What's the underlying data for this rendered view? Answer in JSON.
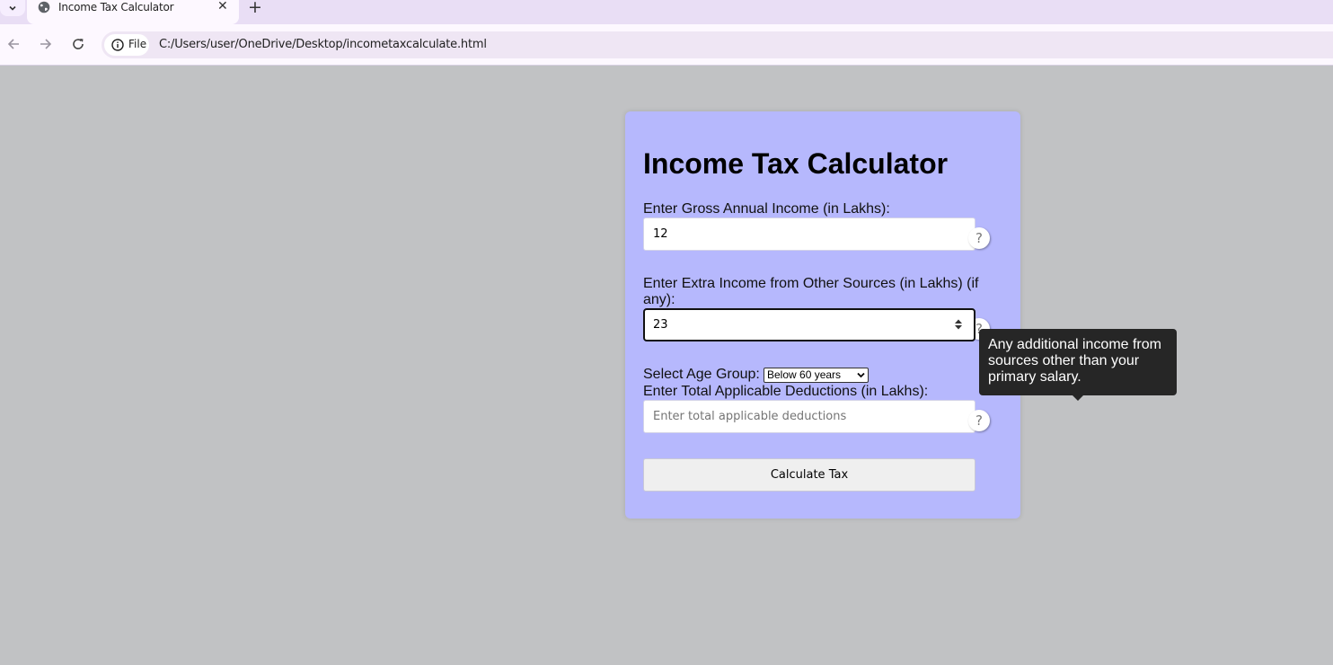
{
  "browser": {
    "tab": {
      "title": "Income Tax Calculator",
      "close_glyph": "✕"
    },
    "new_tab_glyph": "+",
    "address": {
      "scheme_label": "File",
      "url": "C:/Users/user/OneDrive/Desktop/incometaxcalculate.html"
    },
    "icons": [
      "tab-menu-icon",
      "globe-icon",
      "close-icon",
      "plus-icon",
      "back-arrow-icon",
      "forward-arrow-icon",
      "reload-icon",
      "info-icon"
    ]
  },
  "page": {
    "title": "Income Tax Calculator",
    "gross_income": {
      "label": "Enter Gross Annual Income (in Lakhs):",
      "value": "12",
      "placeholder": ""
    },
    "extra_income": {
      "label": "Enter Extra Income from Other Sources (in Lakhs) (if any):",
      "value": "23",
      "placeholder": ""
    },
    "age_group": {
      "label": "Select Age Group:",
      "selected": "Below 60 years"
    },
    "deductions": {
      "label": "Enter Total Applicable Deductions (in Lakhs):",
      "value": "",
      "placeholder": "Enter total applicable deductions"
    },
    "help_glyph": "?",
    "calculate_label": "Calculate Tax",
    "tooltip": "Any additional income from sources other than your primary salary."
  },
  "colors": {
    "page_bg": "#c1c2c4",
    "card_bg": "#b6b8fd",
    "tooltip_bg": "#262626",
    "button_bg": "#efefef"
  }
}
